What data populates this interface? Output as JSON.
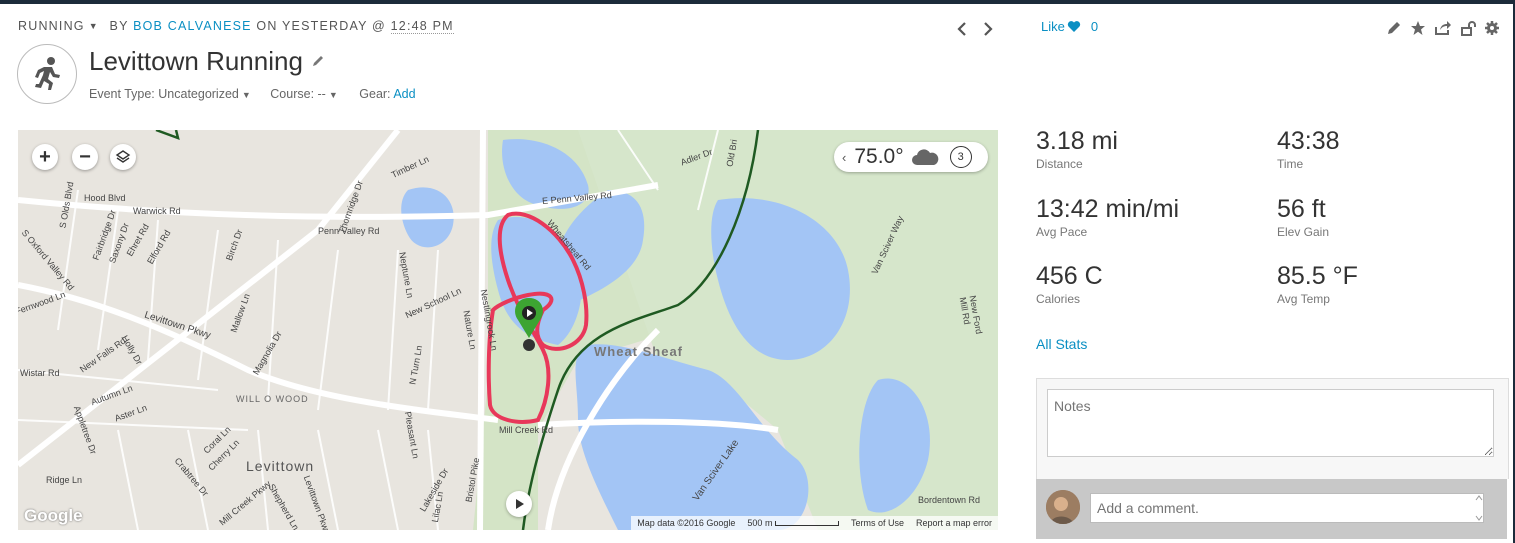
{
  "header": {
    "activity_type": "RUNNING",
    "by": "BY",
    "author": "BOB CALVANESE",
    "on": "ON YESTERDAY @",
    "time": "12:48 PM",
    "title": "Levittown Running",
    "event_type_label": "Event Type: Uncategorized",
    "course_label": "Course: --",
    "gear_label": "Gear:",
    "gear_add": "Add"
  },
  "social": {
    "like_label": "Like",
    "like_count": "0"
  },
  "map": {
    "temperature": "75.0°",
    "lap": "3",
    "google_logo": "Google",
    "footer": {
      "data": "Map data ©2016 Google",
      "scale": "500 m",
      "terms": "Terms of Use",
      "report": "Report a map error"
    },
    "labels": {
      "hood_blvd": "Hood Blvd",
      "warwick": "Warwick Rd",
      "penn_valley": "Penn Valley Rd",
      "e_penn_valley": "E Penn Valley Rd",
      "timber": "Timber Ln",
      "adler": "Adler Dr",
      "old_bri": "Old Bri",
      "wheatsheaf": "Wheatsheaf Rd",
      "wheat_sheaf": "Wheat Sheaf",
      "levittown_pkwy": "Levittown Pkwy",
      "new_falls": "New Falls Rd",
      "will_o_wood": "WILL O WOOD",
      "levittown": "Levittown",
      "mill_creek": "Mill Creek Rd",
      "bristol_pike": "Bristol Pike",
      "van_sciver_lake": "Van Sciver Lake",
      "van_sciver_way": "Van Sciver Way",
      "new_ford_mill": "New Ford Mill Rd",
      "bordentown": "Bordentown Rd",
      "s_oxford": "S Oxford Valley Rd",
      "birch": "Birch Dr",
      "magnolia": "Magnolia Dr",
      "new_school": "New School Ln",
      "neptune": "Neptune Ln",
      "nestlingrock": "Nestlingrock Ln",
      "nature": "Nature Ln",
      "n_turn": "N Turn Ln",
      "pleasant": "Pleasant Ln",
      "coral": "Coral Ln",
      "cherry": "Cherry Ln",
      "crabtree": "Crabtree Dr",
      "ridge": "Ridge Ln",
      "lakeside": "Lakeside Dr",
      "autumn": "Autumn Ln",
      "aster": "Aster Ln",
      "holly": "Holly Dr",
      "mallow": "Mallow Ln",
      "wistar": "Wistar Rd",
      "fernwood": "Fernwood Ln",
      "s_olds": "S Olds Blvd",
      "fairbridge": "Fairbridge Dr",
      "saxony": "Saxony Dr",
      "ehret": "Ehret Rd",
      "elford": "Elford Rd",
      "thornridge": "Thornridge Dr",
      "mill_creek_pkwy": "Mill Creek Pkwy",
      "shepherd": "Shepherd Ln",
      "levittown_pkwy2": "Levittown Pkwy",
      "lilac": "Lilac Ln",
      "appletree": "Appletree Dr"
    }
  },
  "stats": [
    {
      "value": "3.18 mi",
      "label": "Distance"
    },
    {
      "value": "43:38",
      "label": "Time"
    },
    {
      "value": "13:42 min/mi",
      "label": "Avg Pace"
    },
    {
      "value": "56 ft",
      "label": "Elev Gain"
    },
    {
      "value": "456 C",
      "label": "Calories"
    },
    {
      "value": "85.5 °F",
      "label": "Avg Temp"
    }
  ],
  "all_stats": "All Stats",
  "notes_placeholder": "Notes",
  "comment_placeholder": "Add a comment.",
  "colors": {
    "accent": "#0a8fc3",
    "route": "#e8385a",
    "water": "#a3c5f5",
    "rail": "#1f5a22"
  }
}
